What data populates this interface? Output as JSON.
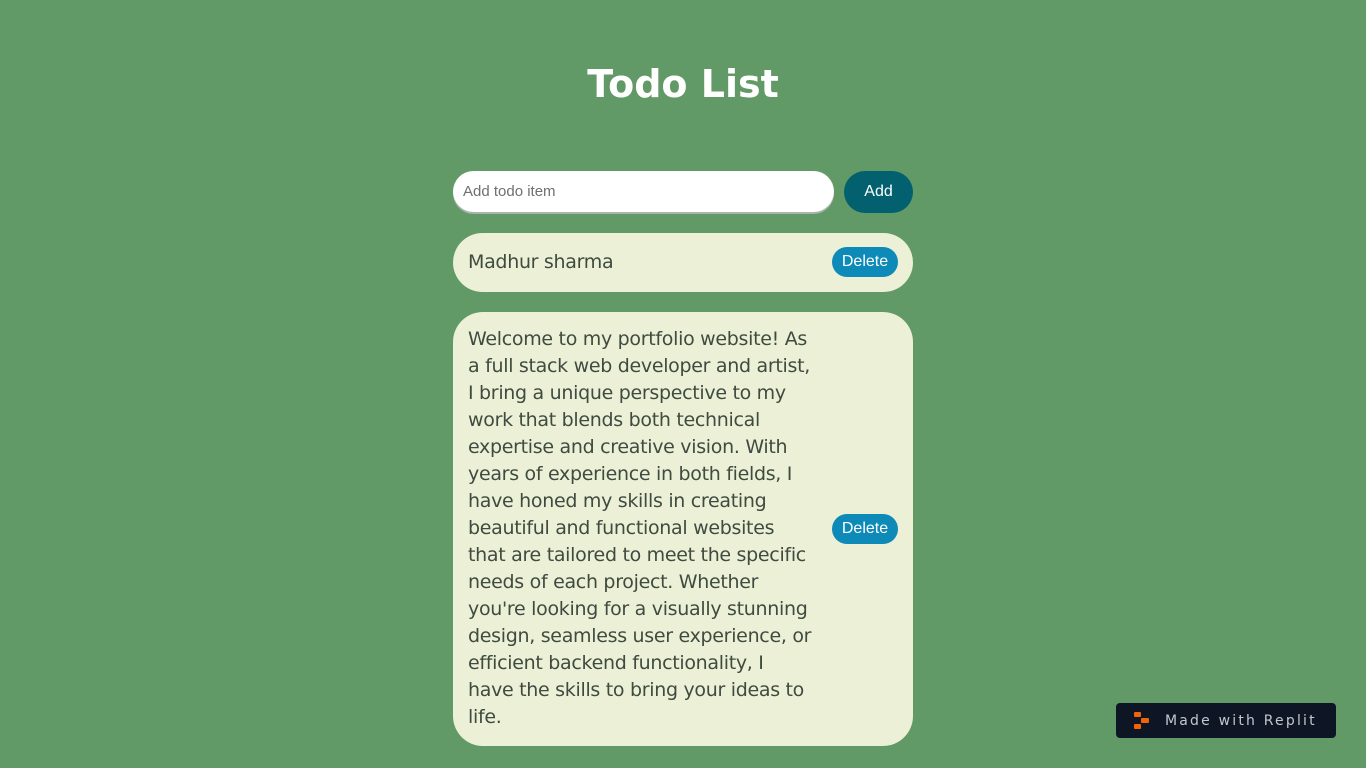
{
  "header": {
    "title": "Todo List"
  },
  "form": {
    "input_placeholder": "Add todo item",
    "input_value": "",
    "add_label": "Add"
  },
  "todos": [
    {
      "text": "Madhur sharma",
      "delete_label": "Delete"
    },
    {
      "text": "Welcome to my portfolio website! As a full stack web developer and artist, I bring a unique perspective to my work that blends both technical expertise and creative vision. With years of experience in both fields, I have honed my skills in creating beautiful and functional websites that are tailored to meet the specific needs of each project. Whether you're looking for a visually stunning design, seamless user experience, or efficient backend functionality, I have the skills to bring your ideas to life.",
      "delete_label": "Delete"
    }
  ],
  "badge": {
    "label": "Made with Replit",
    "icon": "replit-logo-icon"
  },
  "colors": {
    "background": "#619a66",
    "add_button": "#02606f",
    "todo_item_bg": "#ecf0d6",
    "delete_button": "#0e8ab8",
    "badge_bg": "#0e1525",
    "replit_orange": "#f26207"
  }
}
